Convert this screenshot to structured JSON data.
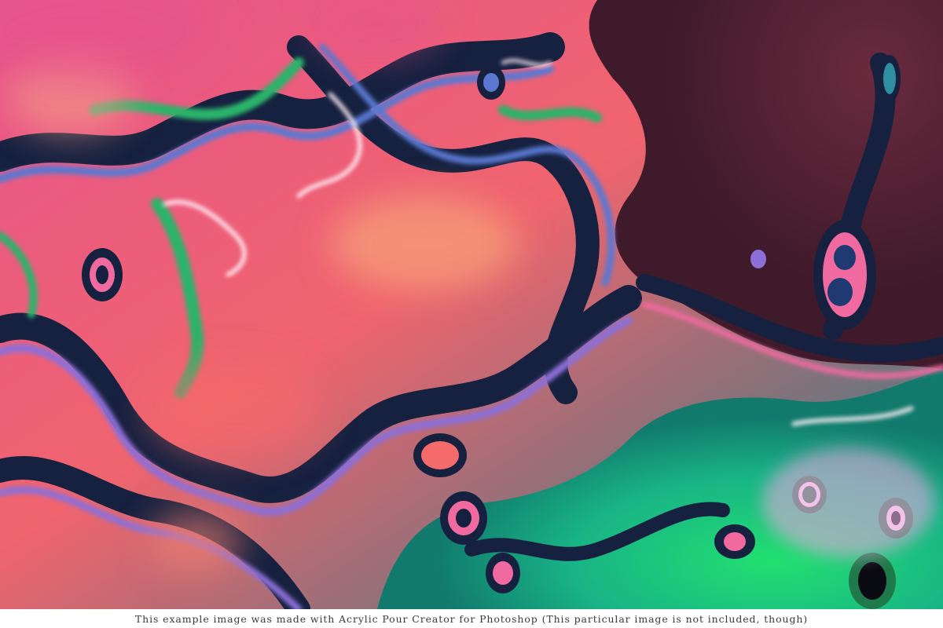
{
  "caption": "This example image was made with Acrylic Pour Creator for Photoshop (This particular image is not included, though)",
  "palette": {
    "coral": "#f0646e",
    "pink": "#e8548c",
    "hot_pink": "#f06aa0",
    "magenta_light": "#f3a6e6",
    "violet": "#8c6fd8",
    "blue": "#5a78d2",
    "navy": "#16213f",
    "teal": "#1f7f86",
    "green": "#1ed46a",
    "emerald": "#18b386",
    "maroon": "#5a2436",
    "peach": "#f5a07a",
    "white_glow": "#fff0f6"
  }
}
